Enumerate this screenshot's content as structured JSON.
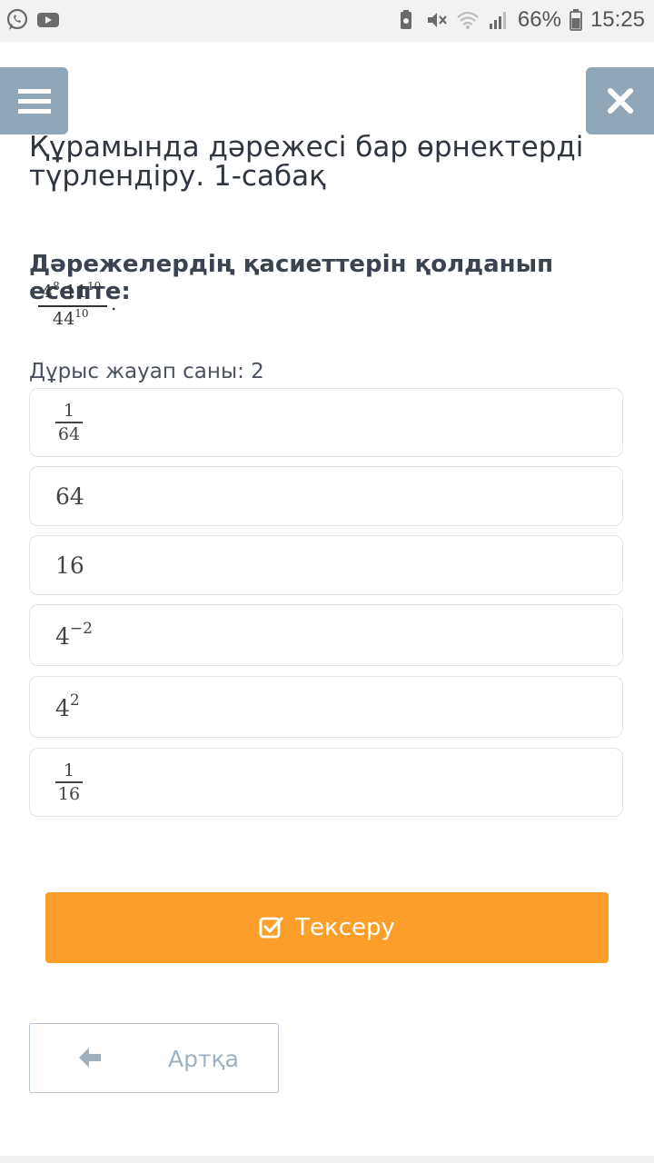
{
  "status_bar": {
    "left_icons": [
      "whatsapp-icon",
      "youtube-icon"
    ],
    "right_icons": [
      "battery-saver-icon",
      "mute-icon",
      "wifi-icon",
      "signal-icon"
    ],
    "battery": "66%",
    "time": "15:25"
  },
  "nav": {
    "menu_icon": "menu-icon",
    "close_icon": "close-icon"
  },
  "lesson": {
    "title": "Құрамында дәрежесі бар өрнектерді түрлендіру. 1-сабақ"
  },
  "question": {
    "prompt": "Дәрежелердің қасиеттерін қолданып есепте:",
    "formula": {
      "num_base1": "4",
      "num_exp1": "8",
      "dot": "·",
      "num_base2": "11",
      "num_exp2": "10",
      "den_base": "44",
      "den_exp": "10",
      "trailing": "."
    },
    "answer_count": "Дұрыс жауап саны: 2"
  },
  "options": {
    "o1": {
      "num": "1",
      "den": "64"
    },
    "o2": {
      "text": "64"
    },
    "o3": {
      "text": "16"
    },
    "o4": {
      "base": "4",
      "exp": "−2"
    },
    "o5": {
      "base": "4",
      "exp": "2"
    },
    "o6": {
      "num": "1",
      "den": "16"
    }
  },
  "check_button": {
    "label": "Тексеру",
    "icon": "checkbox-icon",
    "color": "#fb9e2a"
  },
  "back_button": {
    "label": "Артқа",
    "icon": "arrow-left-icon"
  },
  "colors": {
    "nav_button": "#8fa7b8",
    "text_dark": "#2f3640",
    "border": "#e1e4e8"
  }
}
